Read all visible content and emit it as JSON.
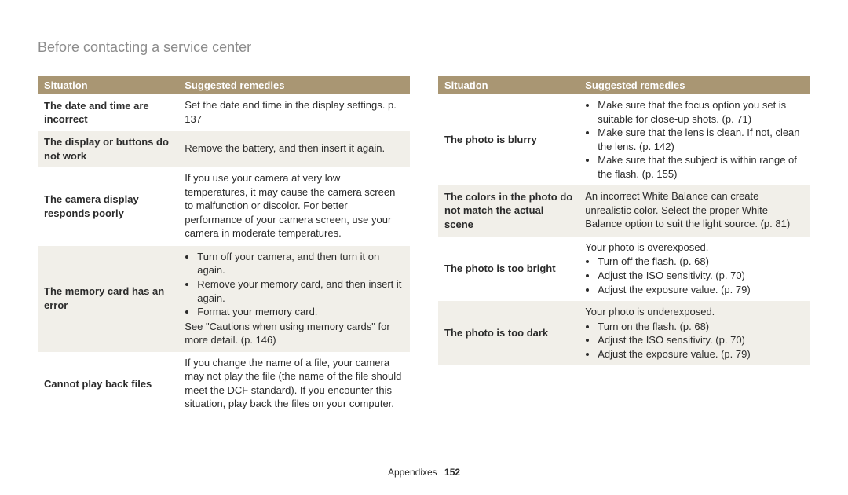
{
  "title": "Before contacting a service center",
  "headers": {
    "situation": "Situation",
    "remedies": "Suggested remedies"
  },
  "left_rows": [
    {
      "situation": "The date and time are incorrect",
      "remedy_intro": "Set the date and time in the display settings. p. 137",
      "remedy_items": [],
      "remedy_outro": ""
    },
    {
      "situation": "The display or buttons do not work",
      "remedy_intro": "Remove the battery, and then insert it again.",
      "remedy_items": [],
      "remedy_outro": ""
    },
    {
      "situation": "The camera display responds poorly",
      "remedy_intro": "If you use your camera at very low temperatures, it may cause the camera screen to malfunction or discolor. For better performance of your camera screen, use your camera in moderate temperatures.",
      "remedy_items": [],
      "remedy_outro": ""
    },
    {
      "situation": "The memory card has an error",
      "remedy_intro": "",
      "remedy_items": [
        "Turn off your camera, and then turn it on again.",
        "Remove your memory card, and then insert it again.",
        "Format your memory card."
      ],
      "remedy_outro": "See \"Cautions when using memory cards\" for more detail. (p. 146)"
    },
    {
      "situation": "Cannot play back files",
      "remedy_intro": "If you change the name of a file, your camera may not play the file (the name of the file should meet the DCF standard). If you encounter this situation, play back the files on your computer.",
      "remedy_items": [],
      "remedy_outro": ""
    }
  ],
  "right_rows": [
    {
      "situation": "The photo is blurry",
      "remedy_intro": "",
      "remedy_items": [
        "Make sure that the focus option you set is suitable for close-up shots. (p. 71)",
        "Make sure that the lens is clean. If not, clean the lens. (p. 142)",
        "Make sure that the subject is within range of the flash. (p. 155)"
      ],
      "remedy_outro": ""
    },
    {
      "situation": "The colors in the photo do not match the actual scene",
      "remedy_intro": "An incorrect White Balance can create unrealistic color. Select the proper White Balance option to suit the light source. (p. 81)",
      "remedy_items": [],
      "remedy_outro": ""
    },
    {
      "situation": "The photo is too bright",
      "remedy_intro": "Your photo is overexposed.",
      "remedy_items": [
        "Turn off the flash. (p. 68)",
        "Adjust the ISO sensitivity. (p. 70)",
        "Adjust the exposure value. (p. 79)"
      ],
      "remedy_outro": ""
    },
    {
      "situation": "The photo is too dark",
      "remedy_intro": "Your photo is underexposed.",
      "remedy_items": [
        "Turn on the flash. (p. 68)",
        "Adjust the ISO sensitivity. (p. 70)",
        "Adjust the exposure value. (p. 79)"
      ],
      "remedy_outro": ""
    }
  ],
  "footer": {
    "section": "Appendixes",
    "page": "152"
  }
}
